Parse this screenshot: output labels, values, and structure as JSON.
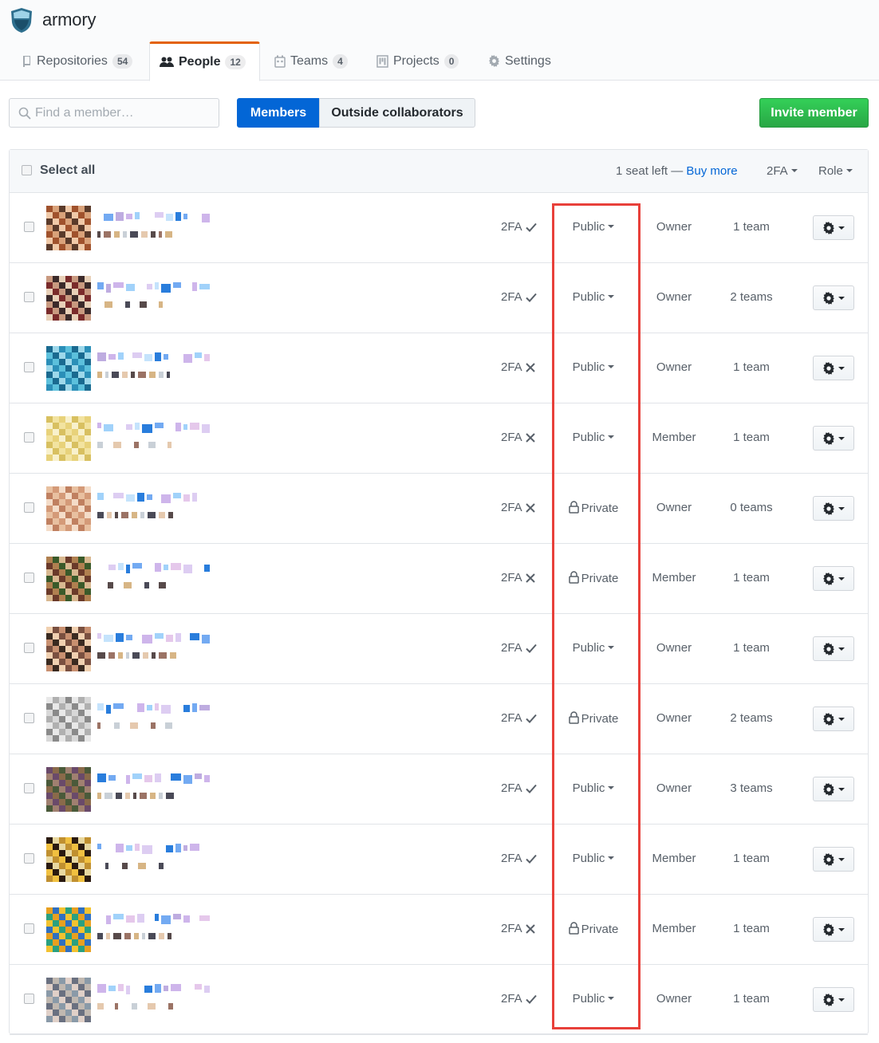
{
  "org": {
    "name": "armory"
  },
  "tabs": [
    {
      "label": "Repositories",
      "count": "54",
      "icon": "repo-icon"
    },
    {
      "label": "People",
      "count": "12",
      "icon": "people-icon"
    },
    {
      "label": "Teams",
      "count": "4",
      "icon": "teams-icon"
    },
    {
      "label": "Projects",
      "count": "0",
      "icon": "project-icon"
    },
    {
      "label": "Settings",
      "icon": "gear-icon"
    }
  ],
  "search": {
    "placeholder": "Find a member…"
  },
  "filters": {
    "members_label": "Members",
    "outside_label": "Outside collaborators"
  },
  "invite_label": "Invite member",
  "table_header": {
    "select_all": "Select all",
    "seats_text": "1 seat left —",
    "buy_more": "Buy more",
    "twofa_filter": "2FA",
    "role_filter": "Role"
  },
  "members": [
    {
      "twofa": "2FA",
      "twofa_enabled": true,
      "visibility": "Public",
      "role": "Owner",
      "teams": "1 team"
    },
    {
      "twofa": "2FA",
      "twofa_enabled": true,
      "visibility": "Public",
      "role": "Owner",
      "teams": "2 teams"
    },
    {
      "twofa": "2FA",
      "twofa_enabled": false,
      "visibility": "Public",
      "role": "Owner",
      "teams": "1 team"
    },
    {
      "twofa": "2FA",
      "twofa_enabled": false,
      "visibility": "Public",
      "role": "Member",
      "teams": "1 team"
    },
    {
      "twofa": "2FA",
      "twofa_enabled": false,
      "visibility": "Private",
      "role": "Owner",
      "teams": "0 teams"
    },
    {
      "twofa": "2FA",
      "twofa_enabled": false,
      "visibility": "Private",
      "role": "Member",
      "teams": "1 team"
    },
    {
      "twofa": "2FA",
      "twofa_enabled": true,
      "visibility": "Public",
      "role": "Owner",
      "teams": "1 team"
    },
    {
      "twofa": "2FA",
      "twofa_enabled": true,
      "visibility": "Private",
      "role": "Owner",
      "teams": "2 teams"
    },
    {
      "twofa": "2FA",
      "twofa_enabled": true,
      "visibility": "Public",
      "role": "Owner",
      "teams": "3 teams"
    },
    {
      "twofa": "2FA",
      "twofa_enabled": true,
      "visibility": "Public",
      "role": "Member",
      "teams": "1 team"
    },
    {
      "twofa": "2FA",
      "twofa_enabled": false,
      "visibility": "Private",
      "role": "Member",
      "teams": "1 team"
    },
    {
      "twofa": "2FA",
      "twofa_enabled": true,
      "visibility": "Public",
      "role": "Owner",
      "teams": "1 team"
    }
  ],
  "colors": {
    "accent_tab": "#e36209",
    "primary_blue": "#0366d6",
    "invite_green": "#2cbe4e",
    "highlight_red": "#e8403a"
  }
}
